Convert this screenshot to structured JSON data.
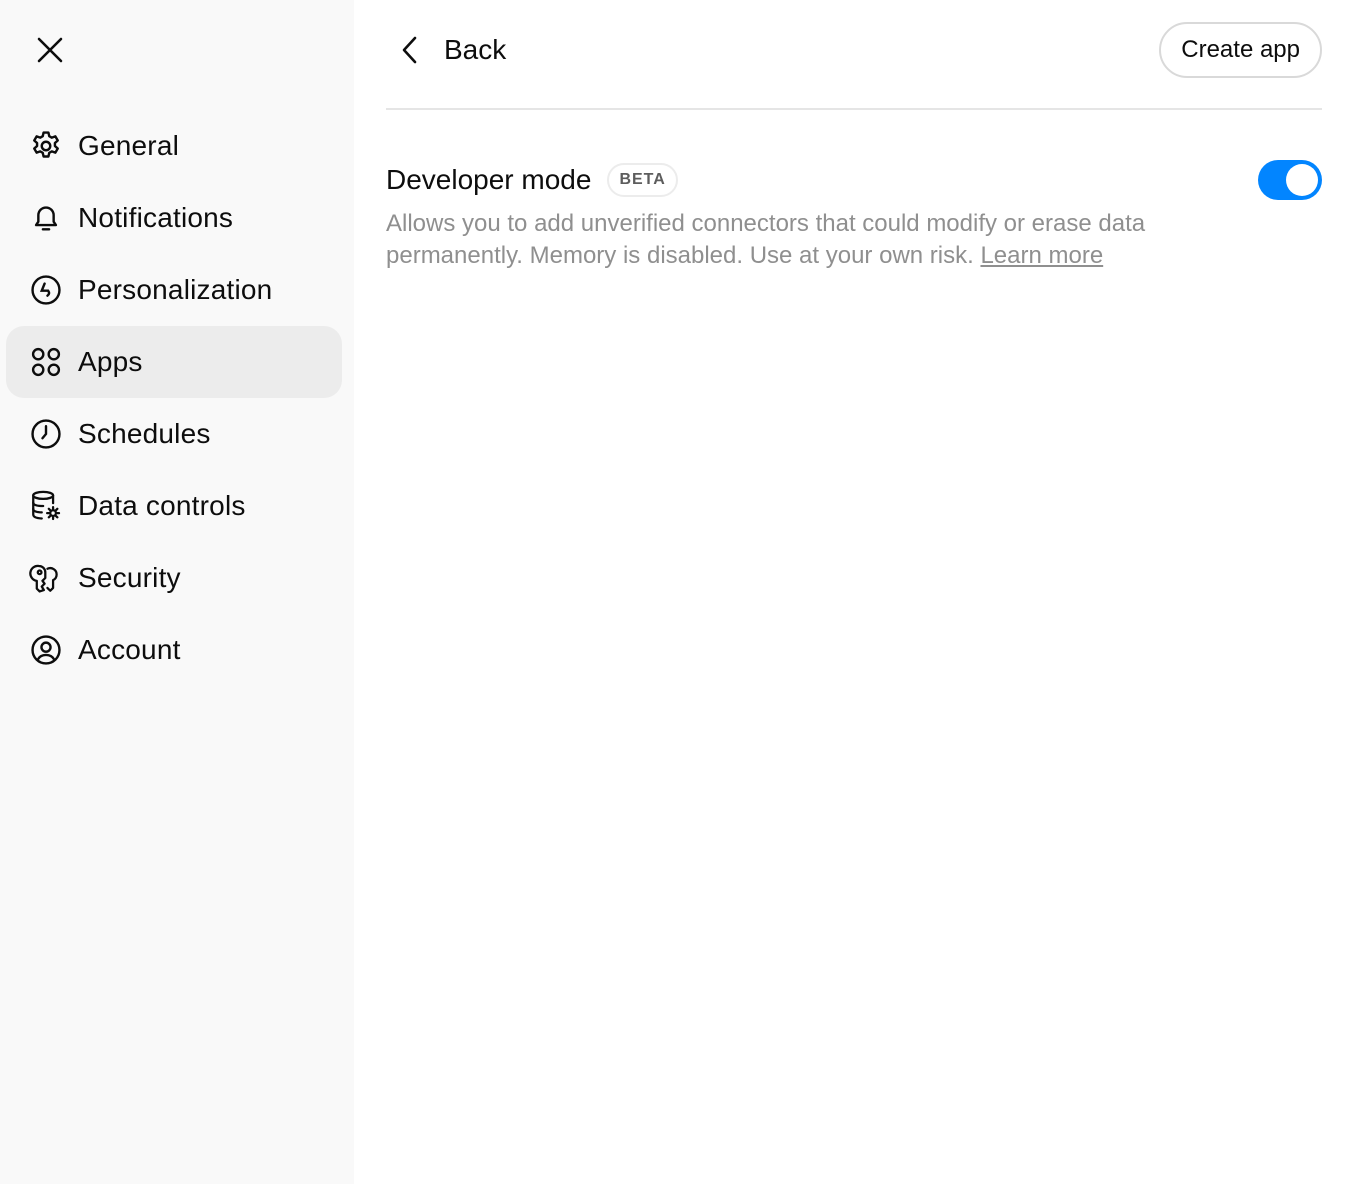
{
  "sidebar": {
    "close_icon": "close-icon",
    "items": [
      {
        "label": "General",
        "icon": "gear-icon",
        "active": false
      },
      {
        "label": "Notifications",
        "icon": "bell-icon",
        "active": false
      },
      {
        "label": "Personalization",
        "icon": "personalization-icon",
        "active": false
      },
      {
        "label": "Apps",
        "icon": "apps-grid-icon",
        "active": true
      },
      {
        "label": "Schedules",
        "icon": "clock-icon",
        "active": false
      },
      {
        "label": "Data controls",
        "icon": "database-gear-icon",
        "active": false
      },
      {
        "label": "Security",
        "icon": "key-icon",
        "active": false
      },
      {
        "label": "Account",
        "icon": "user-circle-icon",
        "active": false
      }
    ]
  },
  "header": {
    "back_label": "Back",
    "back_icon": "chevron-left-icon",
    "create_label": "Create app"
  },
  "developer_mode": {
    "title": "Developer mode",
    "badge": "BETA",
    "description": "Allows you to add unverified connectors that could modify or erase data permanently. Memory is disabled. Use at your own risk.",
    "learn_more": "Learn more",
    "enabled": true
  },
  "colors": {
    "toggle_on": "#0285ff",
    "sidebar_bg": "#f9f9f9",
    "active_item_bg": "#ececec",
    "muted_text": "#8f8f8f"
  }
}
